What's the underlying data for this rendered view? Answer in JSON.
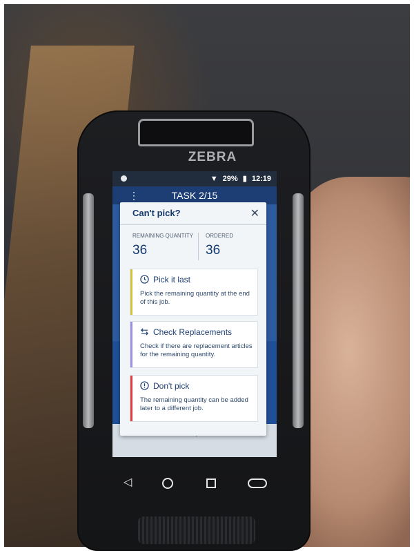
{
  "device": {
    "brand": "ZEBRA",
    "status_bar": {
      "battery": "29%",
      "time": "12:19"
    }
  },
  "app": {
    "header_title": "TASK 2/15",
    "footer_action": "Can't pick?"
  },
  "dialog": {
    "title": "Can't pick?",
    "remaining_label": "REMAINING QUANTITY",
    "remaining_value": "36",
    "ordered_label": "ORDERED",
    "ordered_value": "36",
    "options": [
      {
        "icon": "clock-icon",
        "title": "Pick it last",
        "description": "Pick the remaining quantity at the end of this job.",
        "accent": "#d4c33a"
      },
      {
        "icon": "swap-icon",
        "title": "Check Replacements",
        "description": "Check if there are replacement articles for the remaining quantity.",
        "accent": "#9d8ee0"
      },
      {
        "icon": "alert-icon",
        "title": "Don't pick",
        "description": "The remaining quantity can be added later to a different job.",
        "accent": "#e0393e"
      }
    ]
  },
  "colors": {
    "header": "#1d3e74",
    "primary_text": "#153a6d"
  }
}
